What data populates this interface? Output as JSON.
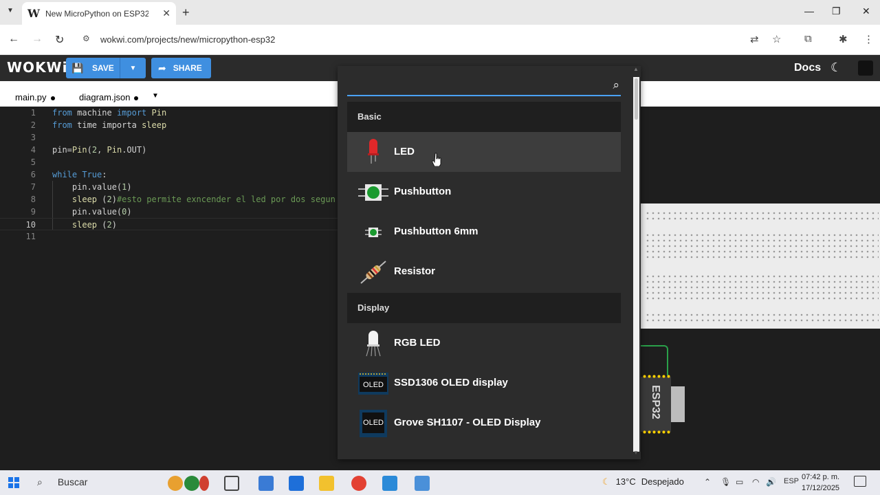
{
  "browser": {
    "tab_title": "New MicroPython on ESP32 P",
    "tab_favicon": "W",
    "url": "wokwi.com/projects/new/micropython-esp32"
  },
  "app": {
    "logo": "WOKWi",
    "save_label": "SAVE",
    "share_label": "SHARE",
    "docs_label": "Docs",
    "accent_color": "#3f8fe0"
  },
  "editor": {
    "tabs": [
      {
        "label": "main.py",
        "modified": true
      },
      {
        "label": "diagram.json",
        "modified": true
      }
    ],
    "active_line": 10,
    "lines": [
      {
        "num": "1",
        "text": "from machine import Pin"
      },
      {
        "num": "2",
        "text": "from time importa sleep"
      },
      {
        "num": "3",
        "text": ""
      },
      {
        "num": "4",
        "text": "pin=Pin(2, Pin.OUT)"
      },
      {
        "num": "5",
        "text": ""
      },
      {
        "num": "6",
        "text": "while True:"
      },
      {
        "num": "7",
        "text": "    pin.value(1)"
      },
      {
        "num": "8",
        "text": "    sleep (2)#esto permite exncender el led por dos segun"
      },
      {
        "num": "9",
        "text": "    pin.value(0)"
      },
      {
        "num": "10",
        "text": "    sleep (2)"
      },
      {
        "num": "11",
        "text": ""
      }
    ]
  },
  "parts_dialog": {
    "search_value": "",
    "categories": [
      {
        "name": "Basic",
        "items": [
          {
            "label": "LED",
            "icon": "led-icon"
          },
          {
            "label": "Pushbutton",
            "icon": "pushbutton-icon"
          },
          {
            "label": "Pushbutton 6mm",
            "icon": "pushbutton-6mm-icon"
          },
          {
            "label": "Resistor",
            "icon": "resistor-icon"
          }
        ]
      },
      {
        "name": "Display",
        "items": [
          {
            "label": "RGB LED",
            "icon": "rgb-led-icon"
          },
          {
            "label": "SSD1306 OLED display",
            "icon": "oled-icon",
            "icon_text": "OLED"
          },
          {
            "label": "Grove SH1107 - OLED Display",
            "icon": "oled-grove-icon",
            "icon_text": "OLED"
          }
        ]
      }
    ]
  },
  "simulation": {
    "board_label": "ESP32"
  },
  "taskbar": {
    "search_label": "Buscar",
    "temperature": "13°C",
    "weather_text": "Despejado",
    "language": "ESP",
    "time": "07:42 p. m.",
    "date": "17/12/2025"
  }
}
